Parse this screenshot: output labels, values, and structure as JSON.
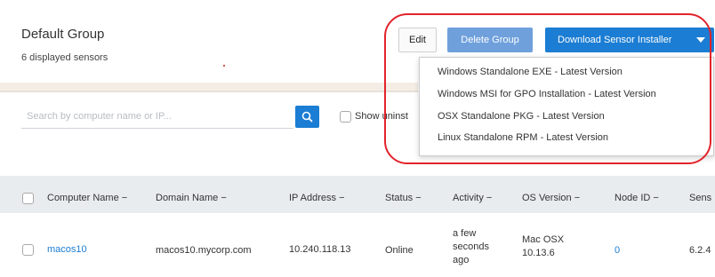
{
  "header": {
    "title": "Default Group",
    "subtitle": "6 displayed sensors"
  },
  "toolbar": {
    "edit_label": "Edit",
    "delete_label": "Delete Group",
    "download_label": "Download Sensor Installer"
  },
  "dropdown": {
    "items": [
      "Windows Standalone EXE - Latest Version",
      "Windows MSI for GPO Installation - Latest Version",
      "OSX Standalone PKG - Latest Version",
      "Linux Standalone RPM - Latest Version"
    ]
  },
  "search": {
    "placeholder": "Search by computer name or IP...",
    "show_label": "Show uninst"
  },
  "table": {
    "columns": [
      "Computer Name",
      "Domain Name",
      "IP Address",
      "Status",
      "Activity",
      "OS Version",
      "Node ID",
      "Sens"
    ],
    "rows": [
      {
        "computer_name": "macos10",
        "domain_name": "macos10.mycorp.com",
        "ip_address": "10.240.118.13",
        "status": "Online",
        "activity": [
          "a few",
          "seconds",
          "ago"
        ],
        "os_version": [
          "Mac OSX",
          "10.13.6"
        ],
        "node_id": "0",
        "sensor": "6.2.4"
      }
    ]
  },
  "colors": {
    "primary": "#1b7dd3",
    "primary_light": "#6fa0dc",
    "annotation": "#e2232b",
    "table_header_bg": "#e9ecef"
  }
}
